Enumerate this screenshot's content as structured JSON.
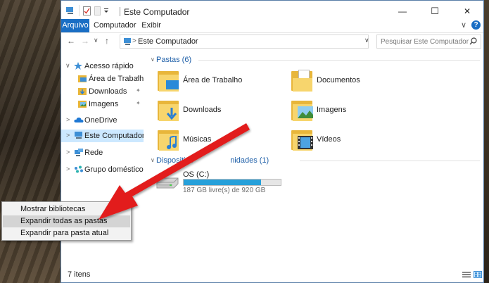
{
  "window": {
    "title": "Este Computador",
    "minimize_glyph": "—",
    "maximize_glyph": "☐",
    "close_glyph": "✕"
  },
  "ribbon": {
    "tabs": [
      {
        "label": "Arquivo",
        "active": true
      },
      {
        "label": "Computador",
        "active": false
      },
      {
        "label": "Exibir",
        "active": false
      }
    ],
    "expand_glyph": "∨",
    "help_glyph": "?"
  },
  "navigation": {
    "back_glyph": "←",
    "forward_glyph": "→",
    "recent_glyph": "∨",
    "up_glyph": "↑",
    "address": {
      "separator": ">",
      "location": "Este Computador"
    },
    "dropdown_glyph": "∨",
    "refresh_glyph": "↻",
    "search_placeholder": "Pesquisar Este Computador"
  },
  "nav_pane": {
    "quick_access": {
      "label": "Acesso rápido",
      "expanded_glyph": "∨"
    },
    "quick_items": [
      {
        "label": "Área de Trabalho",
        "icon": "desktop-folder-icon"
      },
      {
        "label": "Downloads",
        "icon": "downloads-folder-icon"
      },
      {
        "label": "Imagens",
        "icon": "pictures-folder-icon"
      }
    ],
    "pin_glyph": "📌",
    "collapsed_glyph": ">",
    "roots": [
      {
        "label": "OneDrive",
        "icon": "onedrive-icon",
        "selected": false
      },
      {
        "label": "Este Computador",
        "icon": "computer-icon",
        "selected": true
      },
      {
        "label": "Rede",
        "icon": "network-icon",
        "selected": false
      },
      {
        "label": "Grupo doméstico",
        "icon": "homegroup-icon",
        "selected": false
      }
    ]
  },
  "content": {
    "folders_header": "Pastas (6)",
    "folders": [
      {
        "label": "Área de Trabalho",
        "icon": "desktop-folder-icon"
      },
      {
        "label": "Documentos",
        "icon": "documents-folder-icon"
      },
      {
        "label": "Downloads",
        "icon": "downloads-folder-icon"
      },
      {
        "label": "Imagens",
        "icon": "pictures-folder-icon"
      },
      {
        "label": "Músicas",
        "icon": "music-folder-icon"
      },
      {
        "label": "Vídeos",
        "icon": "videos-folder-icon"
      }
    ],
    "devices_header_start": "Dispositivo",
    "devices_header_end": "nidades (1)",
    "drive": {
      "name": "OS (C:)",
      "free_text": "187 GB livre(s) de 920 GB",
      "used_fraction": 0.797
    }
  },
  "status_bar": {
    "item_count": "7 itens"
  },
  "context_menu": {
    "items": [
      {
        "label": "Mostrar bibliotecas",
        "hover": false
      },
      {
        "label": "Expandir todas as pastas",
        "hover": true
      },
      {
        "label": "Expandir para pasta atual",
        "hover": false
      }
    ]
  },
  "colors": {
    "accent": "#1a6ec4",
    "selection": "#cce8ff",
    "drive_fill": "#26a0da",
    "arrow": "#e21b1b"
  }
}
